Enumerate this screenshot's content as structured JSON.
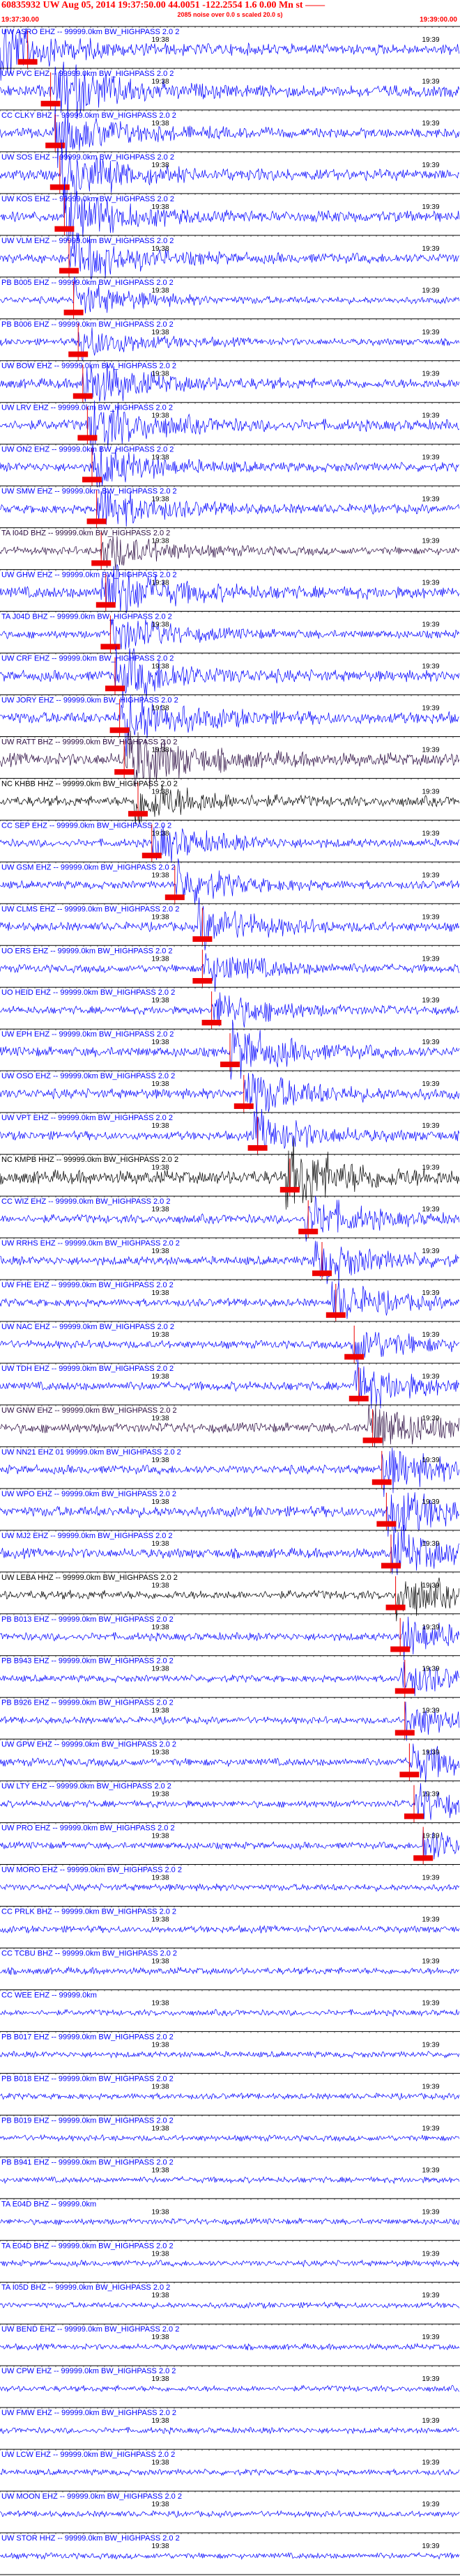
{
  "header": {
    "title": "60835932 UW Aug 05, 2014 19:37:50.00   44.0051  -122.2554  1.6 0.00 Mn st ——",
    "subtitle": "2085 noise over 0.0 s scaled 20.0 s)",
    "time_start": "19:37:30.00",
    "time_end": "19:39:00.00"
  },
  "chart_data": {
    "type": "line",
    "title": "60835932 UW Aug 05, 2014 19:37:50.00   44.0051  -122.2554  1.6 0.00 Mn st ——",
    "x_start": "19:37:30.00",
    "x_end": "19:39:00.00",
    "tick_labels": [
      "19:38",
      "19:39"
    ],
    "colors": {
      "blue": "#0000ff",
      "black": "#000000",
      "dark": "#2a0a40",
      "pick": "#ee0000"
    },
    "channels": [
      {
        "label": "UW ASRO EHZ -- 99999.0km BW_HIGHPASS 2.0 2",
        "color": "blue",
        "amp": 0.55,
        "event": 0.0,
        "pick": 0.06
      },
      {
        "label": "UW PVC EHZ -- 99999.0km BW_HIGHPASS 2.0 2",
        "color": "blue",
        "amp": 0.6,
        "event": 0.12,
        "pick": 0.11
      },
      {
        "label": "CC CLKY BHZ -- 99999.0km BW_HIGHPASS 2.0 2",
        "color": "blue",
        "amp": 0.5,
        "event": 0.12,
        "pick": 0.12
      },
      {
        "label": "UW SOS EHZ -- 99999.0km BW_HIGHPASS 2.0 2",
        "color": "blue",
        "amp": 0.55,
        "event": 0.13,
        "pick": 0.13
      },
      {
        "label": "UW KOS EHZ -- 99999.0km BW_HIGHPASS 2.0 2",
        "color": "blue",
        "amp": 0.55,
        "event": 0.14,
        "pick": 0.14
      },
      {
        "label": "UW VLM EHZ -- 99999.0km BW_HIGHPASS 2.0 2",
        "color": "blue",
        "amp": 0.5,
        "event": 0.15,
        "pick": 0.15
      },
      {
        "label": "PB B005 EHZ -- 99999.0km BW_HIGHPASS 2.0 2",
        "color": "blue",
        "amp": 0.35,
        "event": 0.16,
        "pick": 0.16
      },
      {
        "label": "PB B006 EHZ -- 99999.0km BW_HIGHPASS 2.0 2",
        "color": "blue",
        "amp": 0.35,
        "event": 0.17,
        "pick": 0.17
      },
      {
        "label": "UW BOW EHZ -- 99999.0km BW_HIGHPASS 2.0 2",
        "color": "blue",
        "amp": 0.5,
        "event": 0.18,
        "pick": 0.18
      },
      {
        "label": "UW LRV EHZ -- 99999.0km BW_HIGHPASS 2.0 2",
        "color": "blue",
        "amp": 0.55,
        "event": 0.19,
        "pick": 0.19
      },
      {
        "label": "UW ON2 EHZ -- 99999.0km BW_HIGHPASS 2.0 2",
        "color": "blue",
        "amp": 0.45,
        "event": 0.2,
        "pick": 0.2
      },
      {
        "label": "UW SMW EHZ -- 99999.0km BW_HIGHPASS 2.0 2",
        "color": "blue",
        "amp": 0.45,
        "event": 0.21,
        "pick": 0.21
      },
      {
        "label": "TA I04D BHZ -- 99999.0km BW_HIGHPASS 2.0 2",
        "color": "dark",
        "amp": 0.4,
        "event": 0.22,
        "pick": 0.22
      },
      {
        "label": "UW GHW EHZ -- 99999.0km BW_HIGHPASS 2.0 2",
        "color": "blue",
        "amp": 0.6,
        "event": 0.22,
        "pick": 0.23
      },
      {
        "label": "TA J04D BHZ -- 99999.0km BW_HIGHPASS 2.0 2",
        "color": "blue",
        "amp": 0.4,
        "event": 0.24,
        "pick": 0.24
      },
      {
        "label": "UW CRF EHZ -- 99999.0km BW_HIGHPASS 2.0 2",
        "color": "blue",
        "amp": 0.55,
        "event": 0.25,
        "pick": 0.25
      },
      {
        "label": "UW JORY EHZ -- 99999.0km BW_HIGHPASS 2.0 2",
        "color": "blue",
        "amp": 0.6,
        "event": 0.26,
        "pick": 0.26
      },
      {
        "label": "UW RATT BHZ -- 99999.0km BW_HIGHPASS 2.0 2",
        "color": "dark",
        "amp": 0.65,
        "event": 0.27,
        "pick": 0.27
      },
      {
        "label": "NC KHBB HHZ -- 99999.0km BW_HIGHPASS 2.0 2",
        "color": "black",
        "amp": 0.5,
        "event": 0.29,
        "pick": 0.3
      },
      {
        "label": "CC SEP EHZ -- 99999.0km BW_HIGHPASS 2.0 2",
        "color": "blue",
        "amp": 0.4,
        "event": 0.33,
        "pick": 0.33
      },
      {
        "label": "UW GSM EHZ -- 99999.0km BW_HIGHPASS 2.0 2",
        "color": "blue",
        "amp": 0.4,
        "event": 0.38,
        "pick": 0.38
      },
      {
        "label": "UW CLMS EHZ -- 99999.0km BW_HIGHPASS 2.0 2",
        "color": "blue",
        "amp": 0.45,
        "event": 0.43,
        "pick": 0.44
      },
      {
        "label": "UO ERS EHZ -- 99999.0km BW_HIGHPASS 2.0 2",
        "color": "blue",
        "amp": 0.4,
        "event": 0.44,
        "pick": 0.44
      },
      {
        "label": "UO HEID EHZ -- 99999.0km BW_HIGHPASS 2.0 2",
        "color": "blue",
        "amp": 0.4,
        "event": 0.46,
        "pick": 0.46
      },
      {
        "label": "UW EPH EHZ -- 99999.0km BW_HIGHPASS 2.0 2",
        "color": "blue",
        "amp": 0.5,
        "event": 0.5,
        "pick": 0.5
      },
      {
        "label": "UW OSO EHZ -- 99999.0km BW_HIGHPASS 2.0 2",
        "color": "blue",
        "amp": 0.5,
        "event": 0.53,
        "pick": 0.53
      },
      {
        "label": "UW VPT EHZ -- 99999.0km BW_HIGHPASS 2.0 2",
        "color": "blue",
        "amp": 0.45,
        "event": 0.55,
        "pick": 0.56
      },
      {
        "label": "NC KMPB HHZ -- 99999.0km BW_HIGHPASS 2.0 2",
        "color": "black",
        "amp": 0.7,
        "event": 0.62,
        "pick": 0.63
      },
      {
        "label": "CC WIZ EHZ -- 99999.0km BW_HIGHPASS 2.0 2",
        "color": "blue",
        "amp": 0.45,
        "event": 0.66,
        "pick": 0.67
      },
      {
        "label": "UW RRHS EHZ -- 99999.0km BW_HIGHPASS 2.0 2",
        "color": "blue",
        "amp": 0.45,
        "event": 0.68,
        "pick": 0.7
      },
      {
        "label": "UW FHE EHZ -- 99999.0km BW_HIGHPASS 2.0 2",
        "color": "blue",
        "amp": 0.4,
        "event": 0.72,
        "pick": 0.73
      },
      {
        "label": "UW NAC EHZ -- 99999.0km BW_HIGHPASS 2.0 2",
        "color": "blue",
        "amp": 0.4,
        "event": 0.76,
        "pick": 0.77
      },
      {
        "label": "UW TDH EHZ -- 99999.0km BW_HIGHPASS 2.0 2",
        "color": "blue",
        "amp": 0.45,
        "event": 0.77,
        "pick": 0.78
      },
      {
        "label": "UW GNW EHZ -- 99999.0km BW_HIGHPASS 2.0 2",
        "color": "dark",
        "amp": 0.5,
        "event": 0.8,
        "pick": 0.81
      },
      {
        "label": "UW NN21 EHZ 01 99999.0km BW_HIGHPASS 2.0 2",
        "color": "blue",
        "amp": 0.45,
        "event": 0.83,
        "pick": 0.83
      },
      {
        "label": "UW WPO EHZ -- 99999.0km BW_HIGHPASS 2.0 2",
        "color": "blue",
        "amp": 0.55,
        "event": 0.84,
        "pick": 0.84
      },
      {
        "label": "UW MJ2 EHZ -- 99999.0km BW_HIGHPASS 2.0 2",
        "color": "blue",
        "amp": 0.5,
        "event": 0.85,
        "pick": 0.85
      },
      {
        "label": "UW LEBA HHZ -- 99999.0km BW_HIGHPASS 2.0 2",
        "color": "black",
        "amp": 0.45,
        "event": 0.86,
        "pick": 0.86
      },
      {
        "label": "PB B013 EHZ -- 99999.0km BW_HIGHPASS 2.0 2",
        "color": "blue",
        "amp": 0.4,
        "event": 0.87,
        "pick": 0.87
      },
      {
        "label": "PB B943 EHZ -- 99999.0km BW_HIGHPASS 2.0 2",
        "color": "blue",
        "amp": 0.35,
        "event": 0.87,
        "pick": 0.88
      },
      {
        "label": "PB B926 EHZ -- 99999.0km BW_HIGHPASS 2.0 2",
        "color": "blue",
        "amp": 0.35,
        "event": 0.88,
        "pick": 0.88
      },
      {
        "label": "UW GPW EHZ -- 99999.0km BW_HIGHPASS 2.0 2",
        "color": "blue",
        "amp": 0.4,
        "event": 0.89,
        "pick": 0.89
      },
      {
        "label": "UW LTY EHZ -- 99999.0km BW_HIGHPASS 2.0 2",
        "color": "blue",
        "amp": 0.35,
        "event": 0.9,
        "pick": 0.9
      },
      {
        "label": "UW PRO EHZ -- 99999.0km BW_HIGHPASS 2.0 2",
        "color": "blue",
        "amp": 0.35,
        "event": 0.92,
        "pick": 0.92
      },
      {
        "label": "UW MORO EHZ -- 99999.0km BW_HIGHPASS 2.0 2",
        "color": "blue",
        "amp": 0.35,
        "event": -1,
        "pick": -1
      },
      {
        "label": "CC PRLK BHZ -- 99999.0km BW_HIGHPASS 2.0 2",
        "color": "blue",
        "amp": 0.35,
        "event": -1,
        "pick": -1
      },
      {
        "label": "CC TCBU BHZ -- 99999.0km BW_HIGHPASS 2.0 2",
        "color": "blue",
        "amp": 0.35,
        "event": -1,
        "pick": -1
      },
      {
        "label": "CC WEE EHZ -- 99999.0km",
        "color": "blue",
        "amp": 0.3,
        "event": -1,
        "pick": -1
      },
      {
        "label": "PB B017 EHZ -- 99999.0km BW_HIGHPASS 2.0 2",
        "color": "blue",
        "amp": 0.3,
        "event": -1,
        "pick": -1
      },
      {
        "label": "PB B018 EHZ -- 99999.0km BW_HIGHPASS 2.0 2",
        "color": "blue",
        "amp": 0.3,
        "event": -1,
        "pick": -1
      },
      {
        "label": "PB B019 EHZ -- 99999.0km BW_HIGHPASS 2.0 2",
        "color": "blue",
        "amp": 0.3,
        "event": -1,
        "pick": -1
      },
      {
        "label": "PB B941 EHZ -- 99999.0km BW_HIGHPASS 2.0 2",
        "color": "blue",
        "amp": 0.3,
        "event": -1,
        "pick": -1
      },
      {
        "label": "TA E04D BHZ -- 99999.0km",
        "color": "blue",
        "amp": 0.3,
        "event": -1,
        "pick": -1
      },
      {
        "label": "TA E04D BHZ -- 99999.0km BW_HIGHPASS 2.0 2",
        "color": "blue",
        "amp": 0.3,
        "event": -1,
        "pick": -1
      },
      {
        "label": "TA I05D BHZ -- 99999.0km BW_HIGHPASS 2.0 2",
        "color": "blue",
        "amp": 0.3,
        "event": -1,
        "pick": -1
      },
      {
        "label": "UW BEND EHZ -- 99999.0km BW_HIGHPASS 2.0 2",
        "color": "blue",
        "amp": 0.3,
        "event": -1,
        "pick": -1
      },
      {
        "label": "UW CPW EHZ -- 99999.0km BW_HIGHPASS 2.0 2",
        "color": "blue",
        "amp": 0.3,
        "event": -1,
        "pick": -1
      },
      {
        "label": "UW FMW EHZ -- 99999.0km BW_HIGHPASS 2.0 2",
        "color": "blue",
        "amp": 0.3,
        "event": -1,
        "pick": -1
      },
      {
        "label": "UW LCW EHZ -- 99999.0km BW_HIGHPASS 2.0 2",
        "color": "blue",
        "amp": 0.3,
        "event": -1,
        "pick": -1
      },
      {
        "label": "UW MOON EHZ -- 99999.0km BW_HIGHPASS 2.0 2",
        "color": "blue",
        "amp": 0.3,
        "event": -1,
        "pick": -1
      },
      {
        "label": "UW STOR HHZ -- 99999.0km BW_HIGHPASS 2.0 2",
        "color": "blue",
        "amp": 0.3,
        "event": -1,
        "pick": -1
      }
    ]
  }
}
